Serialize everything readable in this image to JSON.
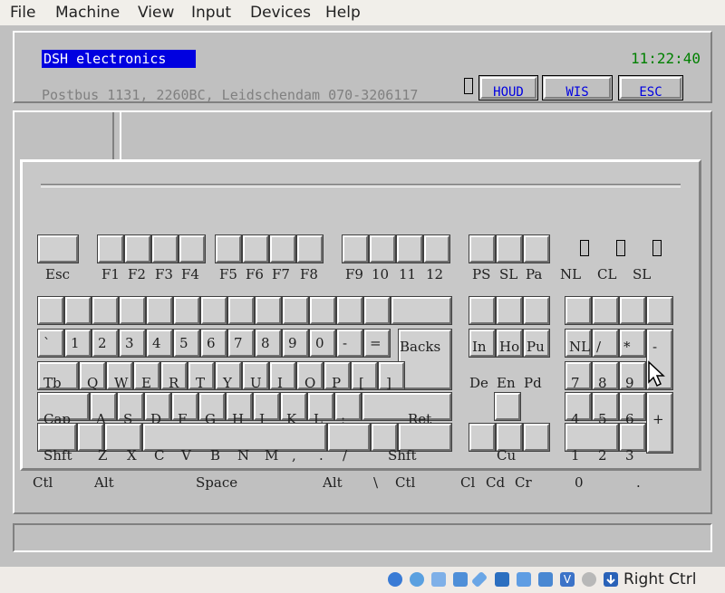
{
  "menubar": {
    "items": [
      "File",
      "Machine",
      "View",
      "Input",
      "Devices",
      "Help"
    ]
  },
  "header": {
    "company": "DSH electronics",
    "time": "11:22:40",
    "address": "Postbus 1131, 2260BC, Leidschendam 070-3206117",
    "buttons": [
      "HOUD",
      "WIS",
      "ESC"
    ]
  },
  "keyboard": {
    "function_labels": [
      "Esc",
      "F1",
      "F2",
      "F3",
      "F4",
      "F5",
      "F6",
      "F7",
      "F8",
      "F9",
      "10",
      "11",
      "12",
      "PS",
      "SL",
      "Pa"
    ],
    "lock_labels": [
      "NL",
      "CL",
      "SL"
    ],
    "row2_labels": [
      "`",
      "1",
      "2",
      "3",
      "4",
      "5",
      "6",
      "7",
      "8",
      "9",
      "0",
      "-",
      "="
    ],
    "row2_extra": [
      "Backs",
      "In",
      "Ho",
      "Pu",
      "NL",
      "/",
      "*",
      "-"
    ],
    "row3_labels": [
      "Tb",
      "Q",
      "W",
      "E",
      "R",
      "T",
      "Y",
      "U",
      "I",
      "O",
      "P",
      "[",
      "]"
    ],
    "row3_extra": [
      "De",
      "En",
      "Pd",
      "7",
      "8",
      "9"
    ],
    "row4_labels": [
      "Cap",
      "A",
      "S",
      "D",
      "F",
      "G",
      "H",
      "J",
      "K",
      "L",
      ";",
      "'",
      "Ret"
    ],
    "row4_extra": [
      "4",
      "5",
      "6",
      "+"
    ],
    "row5_labels": [
      "Shft",
      "Z",
      "X",
      "C",
      "V",
      "B",
      "N",
      "M",
      ",",
      ".",
      "/",
      "Shft"
    ],
    "row5_extra": [
      "Cu",
      "1",
      "2",
      "3"
    ],
    "row6_labels": [
      "Ctl",
      "Alt",
      "Space",
      "Alt",
      "\\",
      "Ctl",
      "Cl",
      "Cd",
      "Cr",
      "0",
      "."
    ]
  },
  "statusbar": {
    "host_key": "Right Ctrl"
  }
}
